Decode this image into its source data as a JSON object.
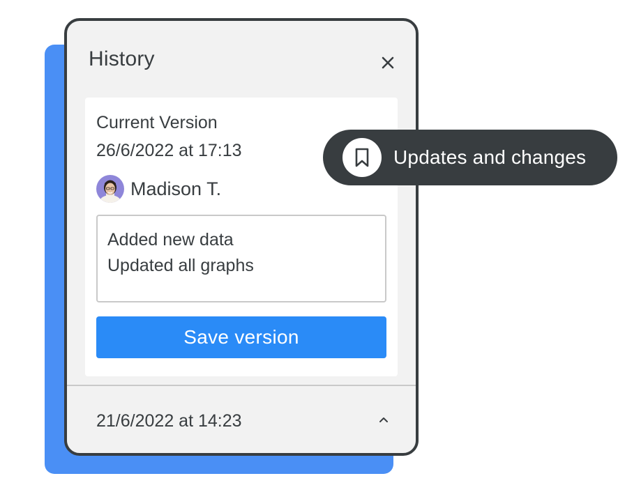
{
  "panel": {
    "title": "History",
    "close_icon": "close-icon"
  },
  "current_version": {
    "label": "Current Version",
    "date": "26/6/2022 at 17:13",
    "user": {
      "name": "Madison T.",
      "avatar": "avatar-photo"
    },
    "notes": [
      "Added new data",
      "Updated all graphs"
    ],
    "save_label": "Save version"
  },
  "previous_versions": [
    {
      "date": "21/6/2022 at 14:23",
      "toggle_icon": "chevron-up-icon"
    }
  ],
  "tooltip": {
    "icon": "bookmark-icon",
    "text": "Updates and changes"
  },
  "colors": {
    "accent": "#2a8bf7",
    "backdrop": "#4a8ff5",
    "dark": "#383d40",
    "panel_bg": "#f2f2f2",
    "border_light": "#c9c9c9"
  }
}
